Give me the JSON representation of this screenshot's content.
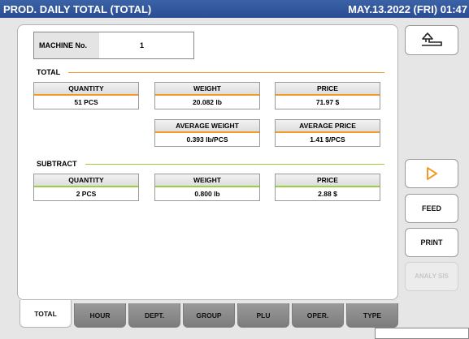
{
  "title": "PROD. DAILY TOTAL (TOTAL)",
  "datetime": "MAY.13.2022 (FRI) 01:47",
  "machine": {
    "label": "MACHINE No.",
    "value": "1"
  },
  "total": {
    "label": "TOTAL",
    "quantity": {
      "label": "QUANTITY",
      "value": "51 PCS"
    },
    "weight": {
      "label": "WEIGHT",
      "value": "20.082 lb"
    },
    "price": {
      "label": "PRICE",
      "value": "71.97 $"
    },
    "avg_weight": {
      "label": "AVERAGE WEIGHT",
      "value": "0.393 lb/PCS"
    },
    "avg_price": {
      "label": "AVERAGE PRICE",
      "value": "1.41 $/PCS"
    }
  },
  "subtract": {
    "label": "SUBTRACT",
    "quantity": {
      "label": "QUANTITY",
      "value": "2 PCS"
    },
    "weight": {
      "label": "WEIGHT",
      "value": "0.800 lb"
    },
    "price": {
      "label": "PRICE",
      "value": "2.88 $"
    }
  },
  "tabs": [
    "TOTAL",
    "HOUR",
    "DEPT.",
    "GROUP",
    "PLU",
    "OPER.",
    "TYPE"
  ],
  "side_buttons": {
    "feed": "FEED",
    "print": "PRINT",
    "analysis": "ANALY SIS"
  },
  "icons": {
    "back": "return-arrow-icon",
    "next": "play-triangle-icon"
  },
  "colors": {
    "title_bar": "#2f559c",
    "total_accent": "#f39a28",
    "subtract_accent": "#9bcf3c",
    "next_icon": "#f39a28"
  }
}
